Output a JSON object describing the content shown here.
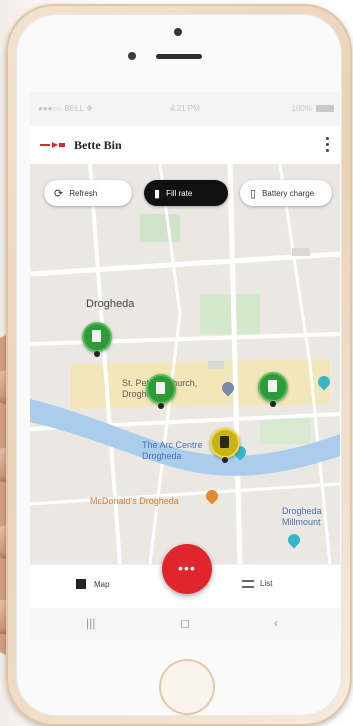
{
  "status_bar": {
    "carrier": "●●●○○ BELL ❖",
    "time": "4:21 PM",
    "battery": "100%"
  },
  "header": {
    "title": "Bette Bin"
  },
  "filters": [
    {
      "label": "Refresh",
      "icon": "refresh-icon",
      "active": false
    },
    {
      "label": "Fill rate",
      "icon": "fill-rate-icon",
      "active": true
    },
    {
      "label": "Battery charge",
      "icon": "battery-icon",
      "active": false
    }
  ],
  "map": {
    "labels": {
      "town": "Drogheda",
      "church": "St. Peter's Church, Drogheda",
      "arc": "The Arc Centre Drogheda",
      "mcdonalds": "McDonald's Drogheda",
      "millmount": "Drogheda Millmount"
    },
    "markers": [
      {
        "status": "green",
        "place": "Drogheda"
      },
      {
        "status": "green",
        "place": "St. Peter's Church"
      },
      {
        "status": "green",
        "place": "East"
      },
      {
        "status": "yellow",
        "place": "The Arc Centre"
      }
    ],
    "colors": {
      "green": "#2f9a3a",
      "yellow": "#c9b21a",
      "river": "#a9cdea"
    }
  },
  "fab": {
    "label": "•••"
  },
  "tabs": [
    {
      "label": "Map",
      "icon": "map-icon"
    },
    {
      "label": "List",
      "icon": "list-icon"
    }
  ],
  "nav": {
    "recent": "|||",
    "home": "◻",
    "back": "‹"
  }
}
